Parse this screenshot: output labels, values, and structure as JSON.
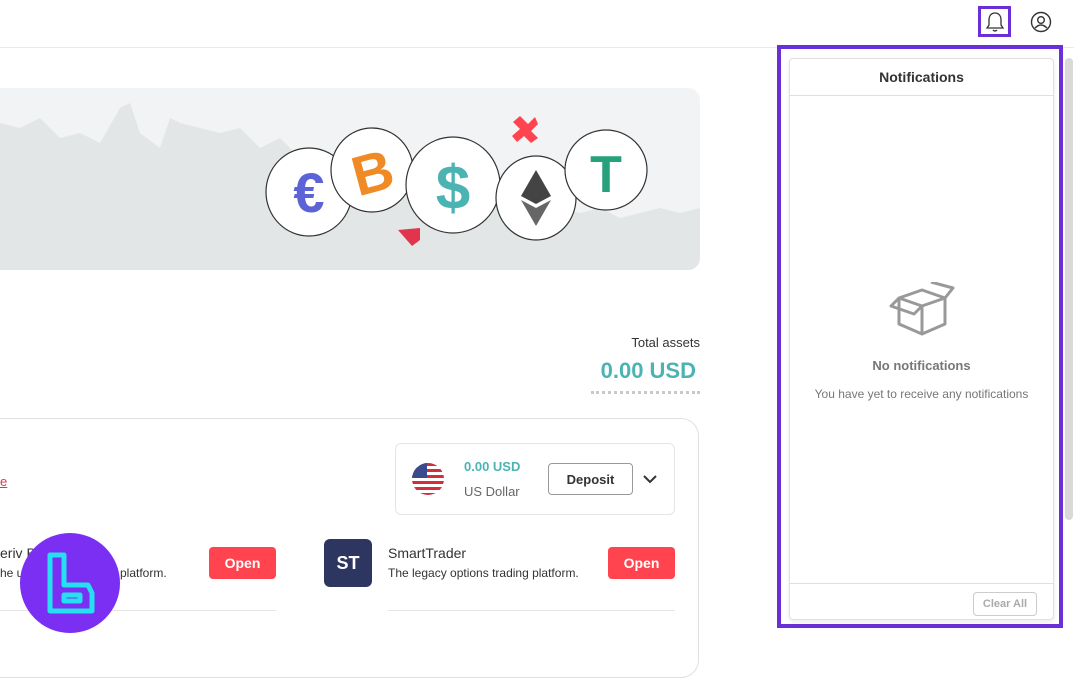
{
  "header": {
    "bell_icon": "bell-icon",
    "user_icon": "user-circle-icon"
  },
  "hero": {
    "coins": [
      "euro",
      "bitcoin",
      "dollar",
      "ethereum",
      "tether"
    ]
  },
  "summary": {
    "total_label": "Total assets",
    "total_value": "0.00 USD"
  },
  "account": {
    "link_text": "e",
    "amount": "0.00 USD",
    "currency": "US Dollar",
    "deposit_label": "Deposit"
  },
  "platforms": [
    {
      "name": "eriv B",
      "desc": "he ul",
      "desc_tail": "platform.",
      "open_label": "Open"
    },
    {
      "name": "SmartTrader",
      "logo": "ST",
      "desc": "The legacy options trading platform.",
      "open_label": "Open"
    }
  ],
  "notifications": {
    "title": "Notifications",
    "empty_title": "No notifications",
    "empty_sub": "You have yet to receive any notifications",
    "clear_label": "Clear All"
  },
  "colors": {
    "accent": "#6a2fd6",
    "teal": "#4bb4b3",
    "red": "#ff444f"
  }
}
